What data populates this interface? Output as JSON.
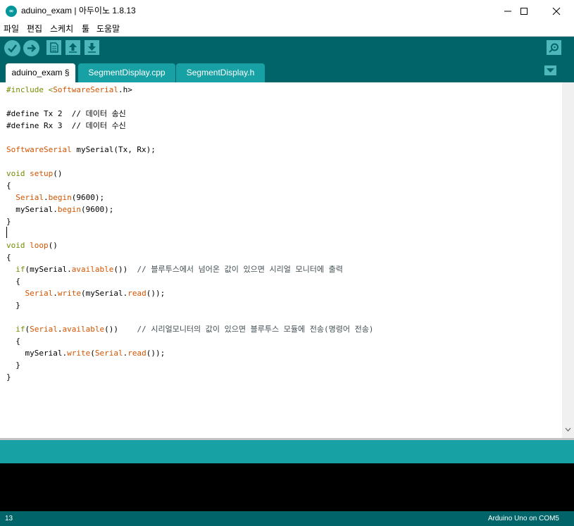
{
  "window": {
    "title": "aduino_exam | 아두이노 1.8.13",
    "icon_text": "∞"
  },
  "menu": [
    {
      "label": "파일"
    },
    {
      "label": "편집"
    },
    {
      "label": "스케치"
    },
    {
      "label": "툴"
    },
    {
      "label": "도움말"
    }
  ],
  "toolbar": {
    "buttons": [
      {
        "name": "verify",
        "icon": "checkmark-icon"
      },
      {
        "name": "upload",
        "icon": "arrow-right-icon"
      },
      {
        "name": "new",
        "icon": "new-file-icon"
      },
      {
        "name": "open",
        "icon": "arrow-up-icon"
      },
      {
        "name": "save",
        "icon": "arrow-down-icon"
      },
      {
        "name": "serial-monitor",
        "icon": "magnifier-icon"
      }
    ],
    "accent": "#4db7bb",
    "background": "#006468"
  },
  "tabs": [
    {
      "label": "aduino_exam §",
      "active": true
    },
    {
      "label": "SegmentDisplay.cpp",
      "active": false
    },
    {
      "label": "SegmentDisplay.h",
      "active": false
    }
  ],
  "code": {
    "l1": {
      "a": "#include <",
      "b": "SoftwareSerial",
      "c": ".h>"
    },
    "l3": {
      "a": "#define Tx 2  // 데이터 송신"
    },
    "l4": {
      "a": "#define Rx 3  // 데이터 수신"
    },
    "l6": {
      "a": "SoftwareSerial",
      "b": " mySerial(Tx, Rx);"
    },
    "l8": {
      "a": "void",
      "b": " ",
      "c": "setup",
      "d": "()"
    },
    "l9": {
      "a": "{"
    },
    "l10": {
      "a": "  ",
      "b": "Serial",
      "c": ".",
      "d": "begin",
      "e": "(9600);"
    },
    "l11": {
      "a": "  mySerial.",
      "b": "begin",
      "c": "(9600);"
    },
    "l12": {
      "a": "}"
    },
    "l14": {
      "a": "void",
      "b": " ",
      "c": "loop",
      "d": "()"
    },
    "l15": {
      "a": "{"
    },
    "l16": {
      "a": "  ",
      "b": "if",
      "c": "(mySerial.",
      "d": "available",
      "e": "())  ",
      "f": "// 블루투스에서 넘어온 값이 있으면 시리얼 모니터에 출력"
    },
    "l17": {
      "a": "  {"
    },
    "l18": {
      "a": "    ",
      "b": "Serial",
      "c": ".",
      "d": "write",
      "e": "(mySerial.",
      "f": "read",
      "g": "());"
    },
    "l19": {
      "a": "  }"
    },
    "l21": {
      "a": "  ",
      "b": "if",
      "c": "(",
      "d": "Serial",
      "e": ".",
      "f": "available",
      "g": "())    ",
      "h": "// 시리얼모니터의 값이 있으면 블루투스 모듈에 전송(명령어 전송)"
    },
    "l22": {
      "a": "  {"
    },
    "l23": {
      "a": "    mySerial.",
      "b": "write",
      "c": "(",
      "d": "Serial",
      "e": ".",
      "f": "read",
      "g": "());"
    },
    "l24": {
      "a": "  }"
    },
    "l25": {
      "a": "}"
    }
  },
  "status": {
    "line_number": "13",
    "board": "Arduino Uno on COM5"
  }
}
